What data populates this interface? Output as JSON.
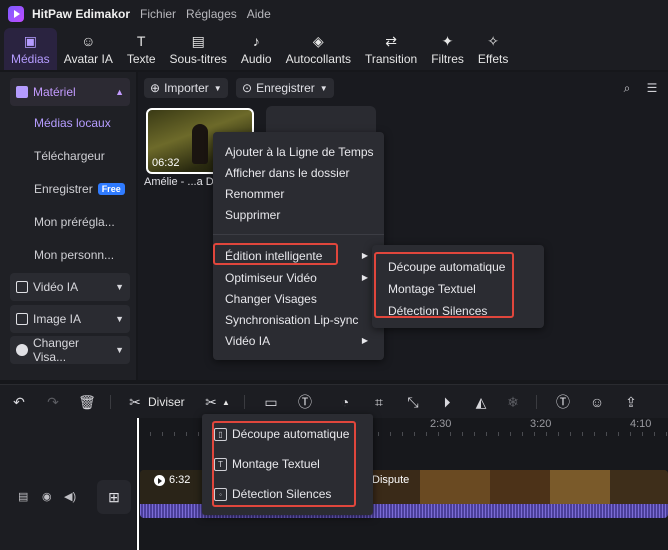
{
  "app": {
    "name": "HitPaw Edimakor",
    "menu": [
      "Fichier",
      "Réglages",
      "Aide"
    ]
  },
  "toolbar": {
    "tabs": [
      {
        "label": "Médias",
        "icon": "media-icon",
        "glyph": "▣"
      },
      {
        "label": "Avatar IA",
        "icon": "avatar-icon",
        "glyph": "☺"
      },
      {
        "label": "Texte",
        "icon": "text-icon",
        "glyph": "T"
      },
      {
        "label": "Sous-titres",
        "icon": "subtitles-icon",
        "glyph": "▤"
      },
      {
        "label": "Audio",
        "icon": "audio-icon",
        "glyph": "♪"
      },
      {
        "label": "Autocollants",
        "icon": "stickers-icon",
        "glyph": "◈"
      },
      {
        "label": "Transition",
        "icon": "transition-icon",
        "glyph": "⇄"
      },
      {
        "label": "Filtres",
        "icon": "filters-icon",
        "glyph": "✦"
      },
      {
        "label": "Effets",
        "icon": "effects-icon",
        "glyph": "✧"
      }
    ],
    "active": "Médias"
  },
  "sidebar": {
    "material": "Matériel",
    "items": [
      "Médias locaux",
      "Téléchargeur",
      "Enregistrer",
      "Mon préréglа...",
      "Mon personn..."
    ],
    "free_badge": "Free",
    "groups": [
      "Vidéo IA",
      "Image IA",
      "Changer Visa..."
    ]
  },
  "media": {
    "import_label": "Importer",
    "record_label": "Enregistrer",
    "clip_duration": "06:32",
    "clip_caption": "Amélie - ...a D"
  },
  "context_menu": {
    "items": [
      "Ajouter à la Ligne de Temps",
      "Afficher dans le dossier",
      "Renommer",
      "Supprimer",
      "Édition intelligente",
      "Optimiseur Vidéo",
      "Changer Visages",
      "Synchronisation Lip-sync",
      "Vidéo IA"
    ],
    "submenu": [
      "Découpe automatique",
      "Montage Textuel",
      "Détection Silences"
    ]
  },
  "timeline_toolbar": {
    "split_label": "Diviser"
  },
  "timeline": {
    "ruler": [
      "2:30",
      "3:20",
      "4:10"
    ],
    "clip_duration": "6:32",
    "clip_text": "Dispute",
    "dropdown": [
      "Découpe automatique",
      "Montage Textuel",
      "Détection Silences"
    ]
  },
  "colors": {
    "accent": "#b59cff",
    "highlight": "#e0463c",
    "badge": "#2f7bff"
  }
}
